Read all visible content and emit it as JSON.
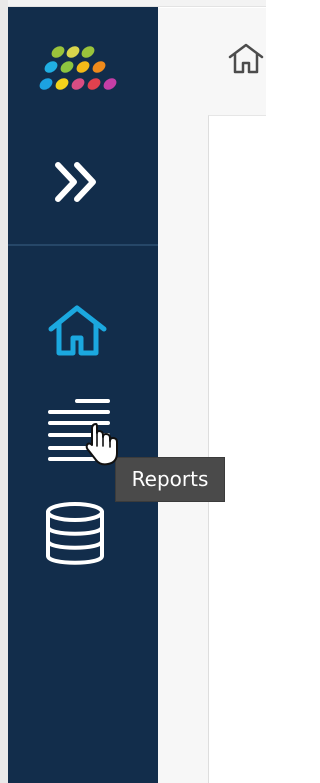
{
  "app": {
    "colors": {
      "sidebar_background": "#122d4b",
      "active_nav": "#1ba8df",
      "inactive_nav": "#ffffff",
      "tooltip_background": "#4a4a4a",
      "content_background": "#f7f7f7"
    }
  },
  "sidebar": {
    "logo": {
      "icon": "colorful-dots-logo"
    },
    "expand_button": {
      "icon": "double-chevron-right-icon"
    },
    "items": [
      {
        "id": "home",
        "icon": "home-icon",
        "active": true
      },
      {
        "id": "reports",
        "icon": "reports-lines-icon",
        "active": false
      },
      {
        "id": "database",
        "icon": "database-icon",
        "active": false
      }
    ]
  },
  "breadcrumb": {
    "home_icon": "home-outline-icon"
  },
  "tooltip": {
    "text": "Reports"
  },
  "cursor": {
    "icon": "hand-pointer-icon"
  }
}
